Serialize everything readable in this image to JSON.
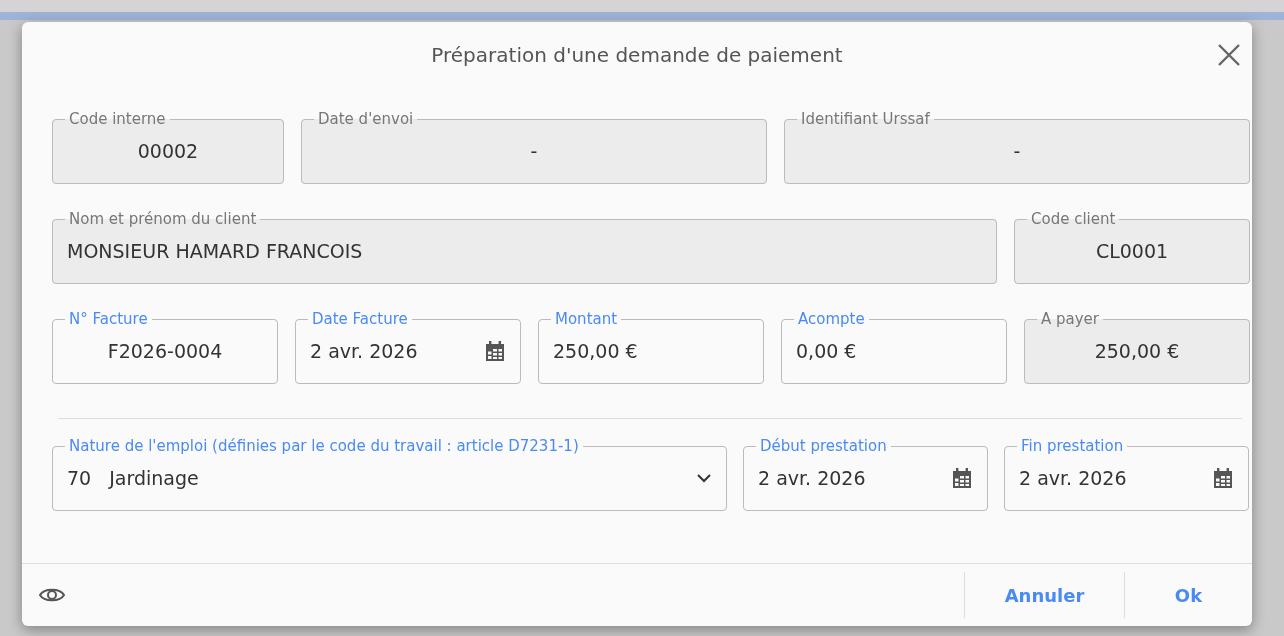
{
  "dialog": {
    "title": "Préparation d'une demande de paiement"
  },
  "rows": [
    [
      {
        "label": "Code interne",
        "value": "00002",
        "kind": "centered",
        "disabled": true
      },
      {
        "label": "Date d'envoi",
        "value": "-",
        "kind": "centered",
        "disabled": true
      },
      {
        "label": "Identifiant Urssaf",
        "value": "-",
        "kind": "centered",
        "disabled": true
      }
    ],
    [
      {
        "label": "Nom et prénom du client",
        "value": "MONSIEUR HAMARD FRANCOIS",
        "kind": "text",
        "disabled": true
      },
      {
        "label": "Code client",
        "value": "CL0001",
        "kind": "centered",
        "disabled": true
      }
    ],
    [
      {
        "label": "N° Facture",
        "value": "F2026-0004",
        "kind": "centered",
        "disabled": false
      },
      {
        "label": "Date Facture",
        "value": "2 avr. 2026",
        "kind": "date",
        "disabled": false
      },
      {
        "label": "Montant",
        "value": "250,00 €",
        "kind": "text",
        "disabled": false
      },
      {
        "label": "Acompte",
        "value": "0,00 €",
        "kind": "text",
        "disabled": false
      },
      {
        "label": "A payer",
        "value": "250,00 €",
        "kind": "centered",
        "disabled": true
      }
    ],
    [
      {
        "label": "Nature de l'emploi (définies par le code du travail : article D7231-1)",
        "code": "70",
        "value": "Jardinage",
        "kind": "select",
        "disabled": false
      },
      {
        "label": "Début prestation",
        "value": "2 avr. 2026",
        "kind": "date",
        "disabled": false
      },
      {
        "label": "Fin prestation",
        "value": "2 avr. 2026",
        "kind": "date",
        "disabled": false
      }
    ]
  ],
  "buttons": [
    {
      "label": "Annuler"
    },
    {
      "label": "Ok"
    }
  ]
}
